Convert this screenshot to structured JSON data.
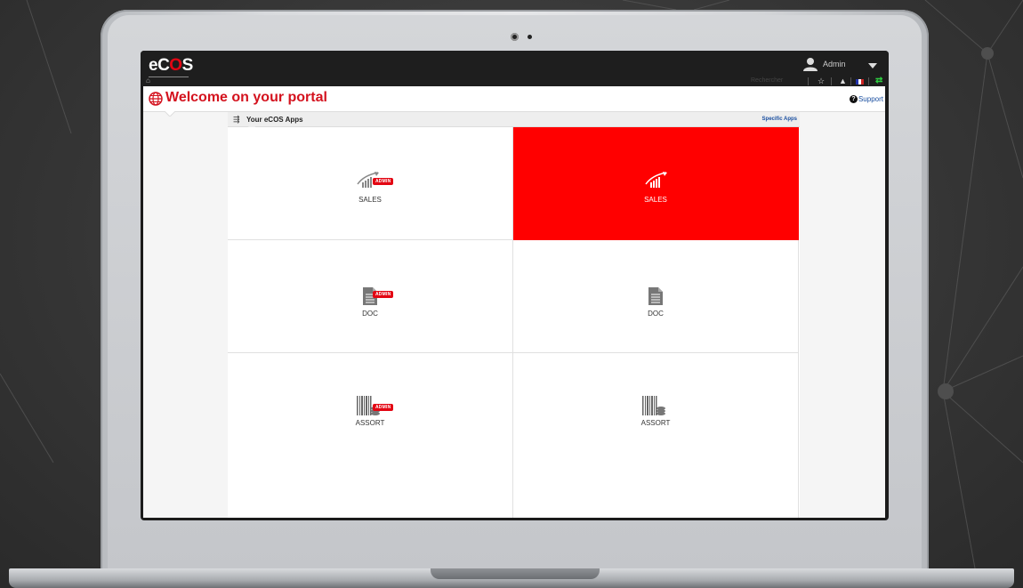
{
  "header": {
    "logo_left": "eC",
    "logo_mid": "O",
    "logo_right": "S",
    "username": "Admin",
    "search_text": "Rechercher"
  },
  "page": {
    "title": "Welcome on your portal",
    "support_label": "Support"
  },
  "apps": {
    "section_title": "Your eCOS Apps",
    "specific_link": "Specific Apps",
    "badge_label": "ADMIN",
    "tiles": [
      {
        "label": "SALES",
        "icon": "sales-chart-icon",
        "admin": true,
        "active": false
      },
      {
        "label": "SALES",
        "icon": "sales-chart-icon",
        "admin": false,
        "active": true
      },
      {
        "label": "DOC",
        "icon": "document-icon",
        "admin": true,
        "active": false
      },
      {
        "label": "DOC",
        "icon": "document-icon",
        "admin": false,
        "active": false
      },
      {
        "label": "ASSORT",
        "icon": "barcode-icon",
        "admin": true,
        "active": false
      },
      {
        "label": "ASSORT",
        "icon": "barcode-icon",
        "admin": false,
        "active": false
      }
    ]
  },
  "colors": {
    "accent": "#e30613",
    "active_tile": "#ff0000",
    "link": "#1a4fa0"
  }
}
